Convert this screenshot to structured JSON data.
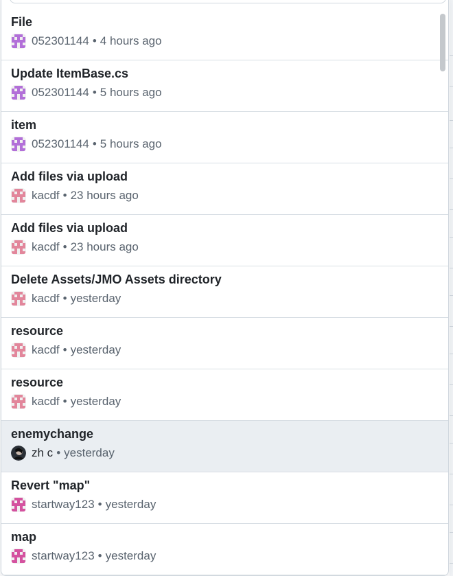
{
  "commits": [
    {
      "title": "File",
      "author": "052301144",
      "time": "4 hours ago",
      "avatar": "purple-identicon-icon"
    },
    {
      "title": "Update ItemBase.cs",
      "author": "052301144",
      "time": "5 hours ago",
      "avatar": "purple-identicon-icon"
    },
    {
      "title": "item",
      "author": "052301144",
      "time": "5 hours ago",
      "avatar": "purple-identicon-icon"
    },
    {
      "title": "Add files via upload",
      "author": "kacdf",
      "time": "23 hours ago",
      "avatar": "pink-identicon-icon"
    },
    {
      "title": "Add files via upload",
      "author": "kacdf",
      "time": "23 hours ago",
      "avatar": "pink-identicon-icon"
    },
    {
      "title": "Delete Assets/JMO Assets directory",
      "author": "kacdf",
      "time": "yesterday",
      "avatar": "pink-identicon-icon"
    },
    {
      "title": "resource",
      "author": "kacdf",
      "time": "yesterday",
      "avatar": "pink-identicon-icon"
    },
    {
      "title": "resource",
      "author": "kacdf",
      "time": "yesterday",
      "avatar": "pink-identicon-icon"
    },
    {
      "title": "enemychange",
      "author": "zh c",
      "time": "yesterday",
      "avatar": "photo-avatar-icon"
    },
    {
      "title": "Revert \"map\"",
      "author": "startway123",
      "time": "yesterday",
      "avatar": "magenta-identicon-icon"
    },
    {
      "title": "map",
      "author": "startway123",
      "time": "yesterday",
      "avatar": "magenta-identicon-icon"
    }
  ],
  "separator": "•",
  "colors": {
    "purple_identicon": "#b26fd8",
    "pink_identicon": "#e2869b",
    "magenta_identicon": "#d4529f",
    "selected_row_bg": "#eaeef2",
    "border": "#d0d7de"
  }
}
